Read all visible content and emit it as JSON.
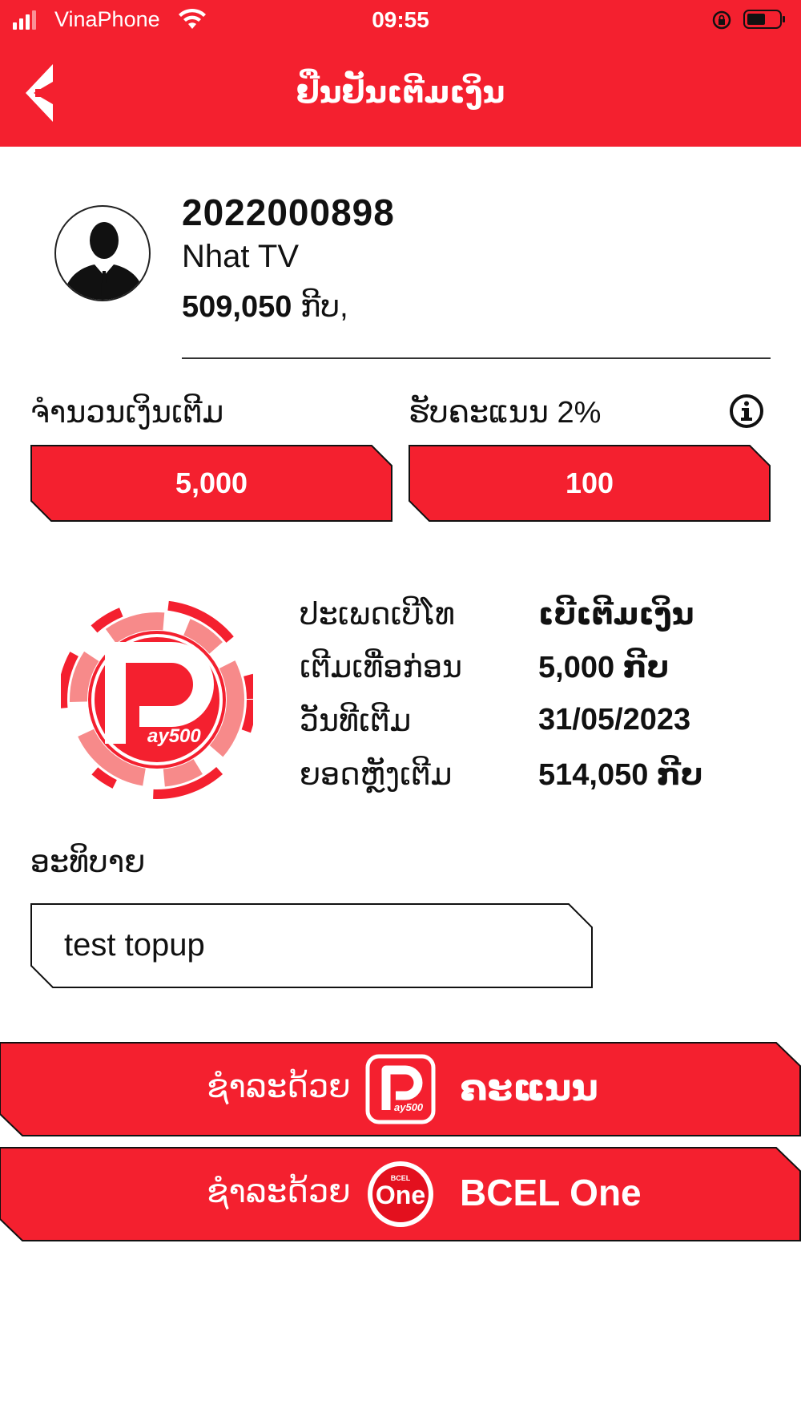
{
  "status_bar": {
    "carrier": "VinaPhone",
    "time": "09:55"
  },
  "header": {
    "title": "ຢືນຢັນເຕີມເງິນ"
  },
  "profile": {
    "account_number": "2022000898",
    "name": "Nhat TV",
    "balance_value": "509,050",
    "balance_unit": "ກີບ,"
  },
  "topup": {
    "amount_label": "ຈຳນວນເງິນເຕີມ",
    "amount_value": "5,000",
    "points_label": "ຮັບຄະແນນ 2%",
    "points_value": "100"
  },
  "details": {
    "rows": [
      {
        "key": "ປະເພດເບີໂທ",
        "value": "ເບີເຕີມເງິນ"
      },
      {
        "key": "ເຕີມເທື່ອກ່ອນ",
        "value": "5,000 ກີບ"
      },
      {
        "key": "ວັນທີເຕີມ",
        "value": "31/05/2023"
      },
      {
        "key": "ຍອດຫຼັງເຕີມ",
        "value": "514,050 ກີບ"
      }
    ],
    "logo_text": "ay500"
  },
  "description": {
    "label": "ອະທິບາຍ",
    "value": "test topup"
  },
  "payment": {
    "points_prefix": "ຊຳລະດ້ວຍ",
    "points_name": "ຄະແນນ",
    "points_logo_text": "ay500",
    "bcel_prefix": "ຊຳລະດ້ວຍ",
    "bcel_name": "BCEL One",
    "bcel_logo_small": "BCEL",
    "bcel_logo_text": "One"
  },
  "colors": {
    "brand_red": "#f4202f",
    "white": "#ffffff",
    "text": "#111111"
  },
  "icons": [
    "signal-icon",
    "wifi-icon",
    "rotation-lock-icon",
    "battery-icon",
    "back-arrow-icon",
    "avatar-icon",
    "info-icon",
    "pay500-logo-icon",
    "bcel-one-logo-icon"
  ]
}
